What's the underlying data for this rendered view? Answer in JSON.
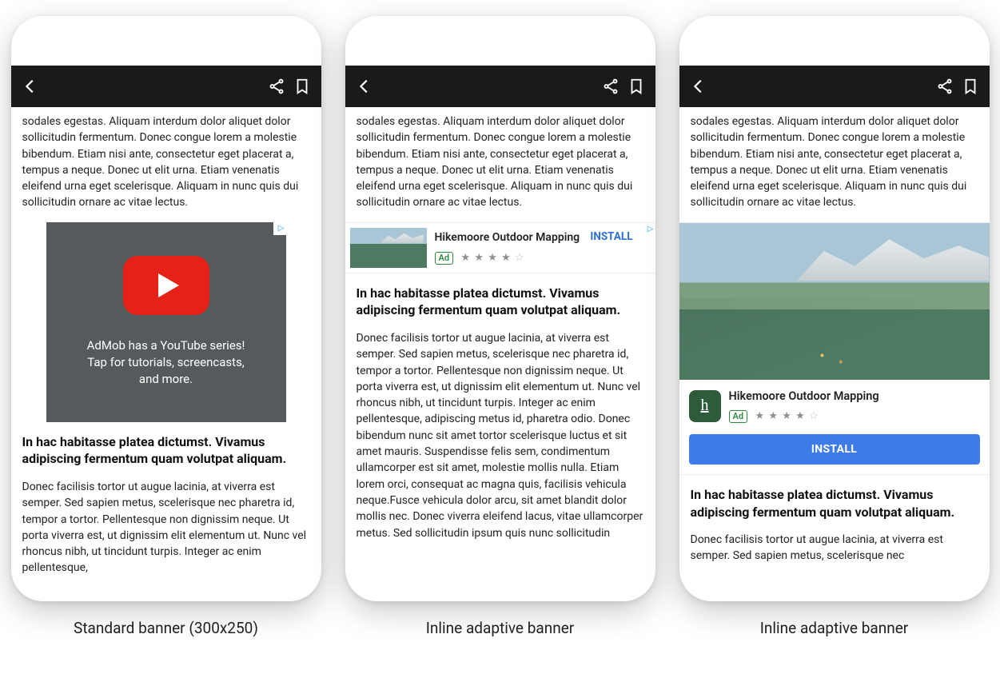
{
  "captions": {
    "phone1": "Standard banner (300x250)",
    "phone2": "Inline adaptive banner",
    "phone3": "Inline adaptive banner"
  },
  "article": {
    "para_top": "sodales egestas. Aliquam interdum dolor aliquet dolor sollicitudin fermentum. Donec congue lorem a molestie bibendum. Etiam nisi ante, consectetur eget placerat a, tempus a neque. Donec ut elit urna. Etiam venenatis eleifend urna eget scelerisque. Aliquam in nunc quis dui sollicitudin ornare ac vitae lectus.",
    "heading": "In hac habitasse platea dictumst. Vivamus adipiscing fermentum quam volutpat aliquam.",
    "para_bottom_long": "Donec facilisis tortor ut augue lacinia, at viverra est semper. Sed sapien metus, scelerisque nec pharetra id, tempor a tortor. Pellentesque non dignissim neque. Ut porta viverra est, ut dignissim elit elementum ut. Nunc vel rhoncus nibh, ut tincidunt turpis. Integer ac enim pellentesque, adipiscing metus id, pharetra odio. Donec bibendum nunc sit amet tortor scelerisque luctus et sit amet mauris. Suspendisse felis sem, condimentum ullamcorper est sit amet, molestie mollis nulla. Etiam lorem orci, consequat ac magna quis, facilisis vehicula neque.Fusce vehicula dolor arcu, sit amet blandit dolor mollis nec. Donec viverra eleifend lacus, vitae ullamcorper metus. Sed sollicitudin ipsum quis nunc sollicitudin",
    "para_bottom_medium": "Donec facilisis tortor ut augue lacinia, at viverra est semper. Sed sapien metus, scelerisque nec pharetra id, tempor a tortor. Pellentesque non dignissim neque. Ut porta viverra est, ut dignissim elit elementum ut. Nunc vel rhoncus nibh, ut tincidunt turpis. Integer ac enim pellentesque,",
    "para_bottom_short": "Donec facilisis tortor ut augue lacinia, at viverra est semper. Sed sapien metus, scelerisque nec"
  },
  "ad1": {
    "line1": "AdMob has a YouTube series!",
    "line2": "Tap for tutorials, screencasts,",
    "line3": "and more.",
    "adchoices_glyph": "▷"
  },
  "ad2": {
    "title": "Hikemoore Outdoor Mapping",
    "badge": "Ad",
    "stars_filled": "★ ★ ★ ★",
    "stars_empty": " ☆",
    "install": "INSTALL",
    "adchoices_glyph": "▷"
  },
  "ad3": {
    "title": "Hikemoore Outdoor Mapping",
    "badge": "Ad",
    "stars_filled": "★ ★ ★ ★",
    "stars_empty": " ☆",
    "install": "INSTALL",
    "app_icon_glyph": "h",
    "adchoices_glyph": "▷"
  }
}
